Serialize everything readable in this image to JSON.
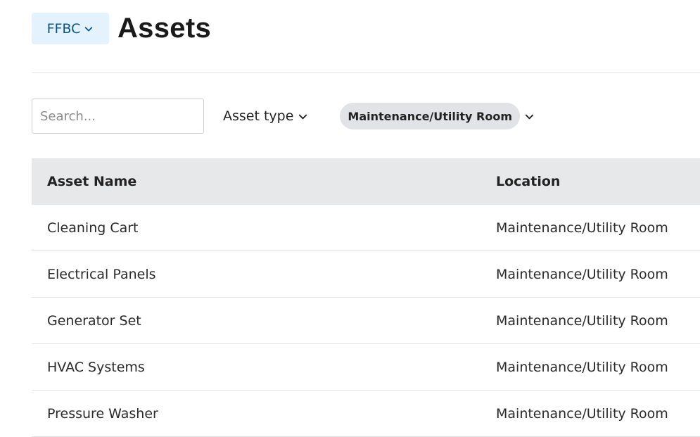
{
  "header": {
    "org_label": "FFBC",
    "title": "Assets"
  },
  "filters": {
    "search_placeholder": "Search...",
    "asset_type_label": "Asset type",
    "active_chip": "Maintenance/Utility Room"
  },
  "table": {
    "columns": [
      "Asset Name",
      "Location"
    ],
    "rows": [
      {
        "name": "Cleaning Cart",
        "location": "Maintenance/Utility Room"
      },
      {
        "name": "Electrical Panels",
        "location": "Maintenance/Utility Room"
      },
      {
        "name": "Generator Set",
        "location": "Maintenance/Utility Room"
      },
      {
        "name": "HVAC Systems",
        "location": "Maintenance/Utility Room"
      },
      {
        "name": "Pressure Washer",
        "location": "Maintenance/Utility Room"
      }
    ]
  },
  "colors": {
    "org_button_bg": "#e3f2fc",
    "org_button_text": "#0b5688",
    "chip_bg": "#e1e3e6",
    "table_header_bg": "#e7e8ea"
  },
  "icons": {
    "org_caret": "chevron-down-icon",
    "asset_type_caret": "chevron-down-icon",
    "chip_caret": "chevron-down-icon"
  }
}
